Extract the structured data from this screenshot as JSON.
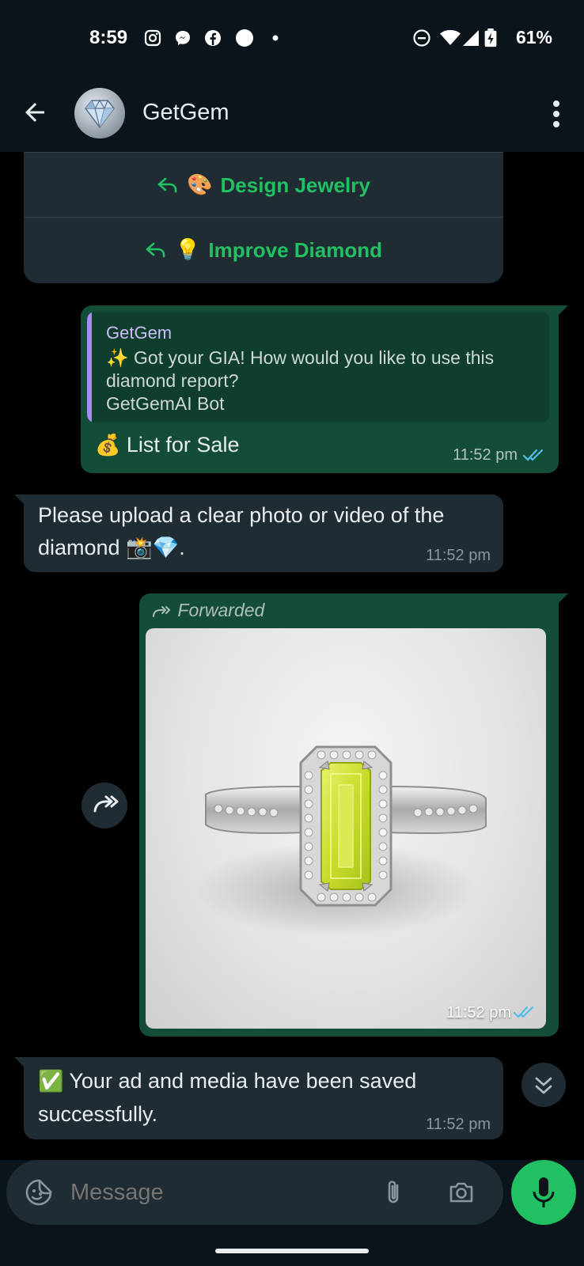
{
  "status_bar": {
    "time": "8:59",
    "battery_percent": "61%",
    "left_icons": [
      "instagram-icon",
      "messenger-icon",
      "facebook-icon",
      "circle-icon",
      "dot-icon"
    ],
    "right_icons": [
      "do-not-disturb-icon",
      "wifi-icon",
      "signal-icon",
      "battery-charging-icon"
    ]
  },
  "header": {
    "contact_name": "GetGem",
    "avatar": "diamond-avatar"
  },
  "keyboard_buttons": [
    {
      "emoji": "🎨",
      "label": "Design Jewelry"
    },
    {
      "emoji": "💡",
      "label": "Improve Diamond"
    }
  ],
  "messages": [
    {
      "direction": "outgoing",
      "quote": {
        "name": "GetGem",
        "text": "✨ Got your GIA! How would you like to use this diamond report?",
        "footer": "GetGemAI Bot"
      },
      "emoji": "💰",
      "text": "List for Sale",
      "time": "11:52 pm",
      "status": "read"
    },
    {
      "direction": "incoming",
      "text_line1": "Please upload a clear photo or video of the",
      "text_line2": "diamond 📸💎.",
      "time": "11:52 pm"
    },
    {
      "direction": "outgoing",
      "forwarded_label": "Forwarded",
      "media": "ring-photo",
      "time": "11:52 pm",
      "status": "read"
    },
    {
      "direction": "incoming",
      "emoji": "✅",
      "text_line1": "Your ad and media have been saved",
      "text_line2": "successfully.",
      "time": "11:52 pm"
    }
  ],
  "composer": {
    "placeholder": "Message"
  },
  "colors": {
    "background": "#000000",
    "header": "#0b141a",
    "incoming_bubble": "#1f2c34",
    "outgoing_bubble": "#144d37",
    "accent_green": "#21c063",
    "read_ticks": "#53bdeb"
  }
}
